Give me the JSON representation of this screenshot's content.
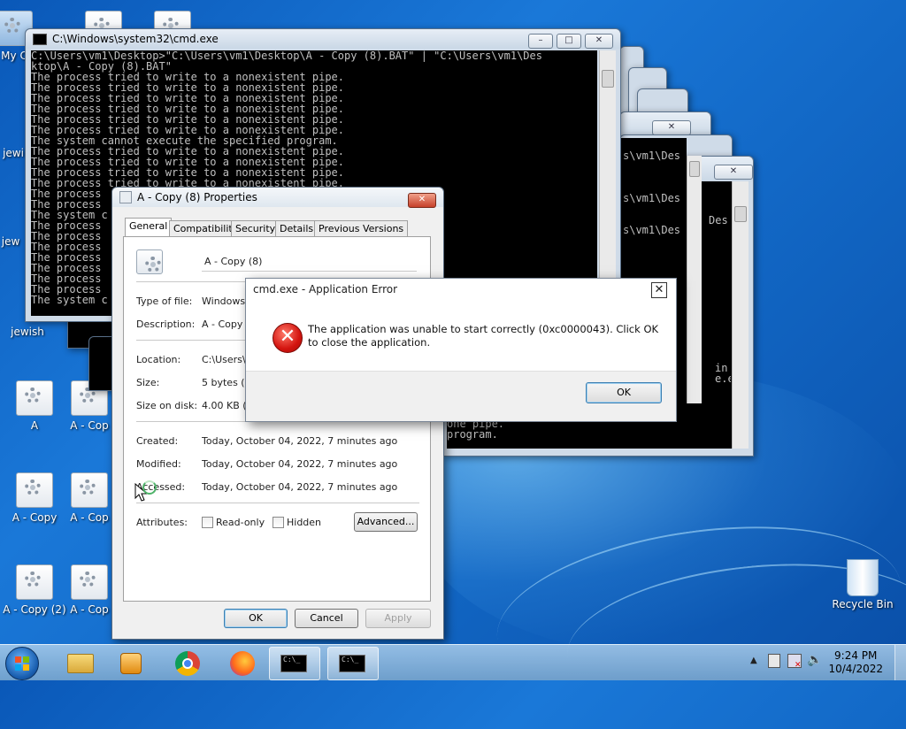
{
  "desktop": {
    "icons_left": [
      {
        "label": "My C"
      },
      {
        "label": "jewi"
      },
      {
        "label": "jew"
      },
      {
        "label": "jewish"
      },
      {
        "label": "A"
      },
      {
        "label": "A - Cop"
      },
      {
        "label": "A - Copy"
      },
      {
        "label": "A - Cop"
      },
      {
        "label": "A - Copy (2)"
      },
      {
        "label": "A - Cop"
      }
    ],
    "recycle_bin": "Recycle Bin"
  },
  "cmd_main": {
    "title": "C:\\Windows\\system32\\cmd.exe",
    "lines": [
      "C:\\Users\\vm1\\Desktop>\"C:\\Users\\vm1\\Desktop\\A - Copy (8).BAT\" | \"C:\\Users\\vm1\\Des",
      "ktop\\A - Copy (8).BAT\"",
      "The process tried to write to a nonexistent pipe.",
      "The process tried to write to a nonexistent pipe.",
      "The process tried to write to a nonexistent pipe.",
      "The process tried to write to a nonexistent pipe.",
      "The process tried to write to a nonexistent pipe.",
      "The process tried to write to a nonexistent pipe.",
      "The system cannot execute the specified program.",
      "The process tried to write to a nonexistent pipe.",
      "The process tried to write to a nonexistent pipe.",
      "The process tried to write to a nonexistent pipe.",
      "The process tried to write to a nonexistent pipe.",
      "The process",
      "The process",
      "The system c",
      "The process",
      "The process",
      "The process",
      "The process",
      "The process",
      "The process",
      "The process",
      "The system c"
    ]
  },
  "cmd_right": {
    "lines": [
      "s\\vm1\\Des",
      "",
      "",
      "s\\vm1\\Des",
      "",
      "",
      "s\\vm1\\Des"
    ],
    "lines2": [
      "Des"
    ],
    "tail": [
      "in",
      "e.e"
    ],
    "bottom": [
      "one pipe.",
      "program."
    ]
  },
  "properties": {
    "title": "A - Copy (8) Properties",
    "tabs": [
      "General",
      "Compatibility",
      "Security",
      "Details",
      "Previous Versions"
    ],
    "name_value": "A - Copy (8)",
    "type_label": "Type of file:",
    "type_value": "Windows",
    "desc_label": "Description:",
    "desc_value": "A - Copy",
    "location_label": "Location:",
    "location_value": "C:\\Users\\",
    "size_label": "Size:",
    "size_value": "5 bytes (5",
    "sod_label": "Size on disk:",
    "sod_value": "4.00 KB (4",
    "created_label": "Created:",
    "created_value": "Today, October 04, 2022, 7 minutes ago",
    "modified_label": "Modified:",
    "modified_value": "Today, October 04, 2022, 7 minutes ago",
    "accessed_label": "Accessed:",
    "accessed_value": "Today, October 04, 2022, 7 minutes ago",
    "attributes_label": "Attributes:",
    "readonly_label": "Read-only",
    "hidden_label": "Hidden",
    "advanced_label": "Advanced...",
    "ok_label": "OK",
    "cancel_label": "Cancel",
    "apply_label": "Apply"
  },
  "error_dialog": {
    "title": "cmd.exe - Application Error",
    "message": "The application was unable to start correctly (0xc0000043). Click OK to close the application.",
    "ok_label": "OK",
    "icon": "error-icon"
  },
  "taskbar": {
    "time": "9:24 PM",
    "date": "10/4/2022",
    "cmd_icon_text": "C:\\_"
  }
}
